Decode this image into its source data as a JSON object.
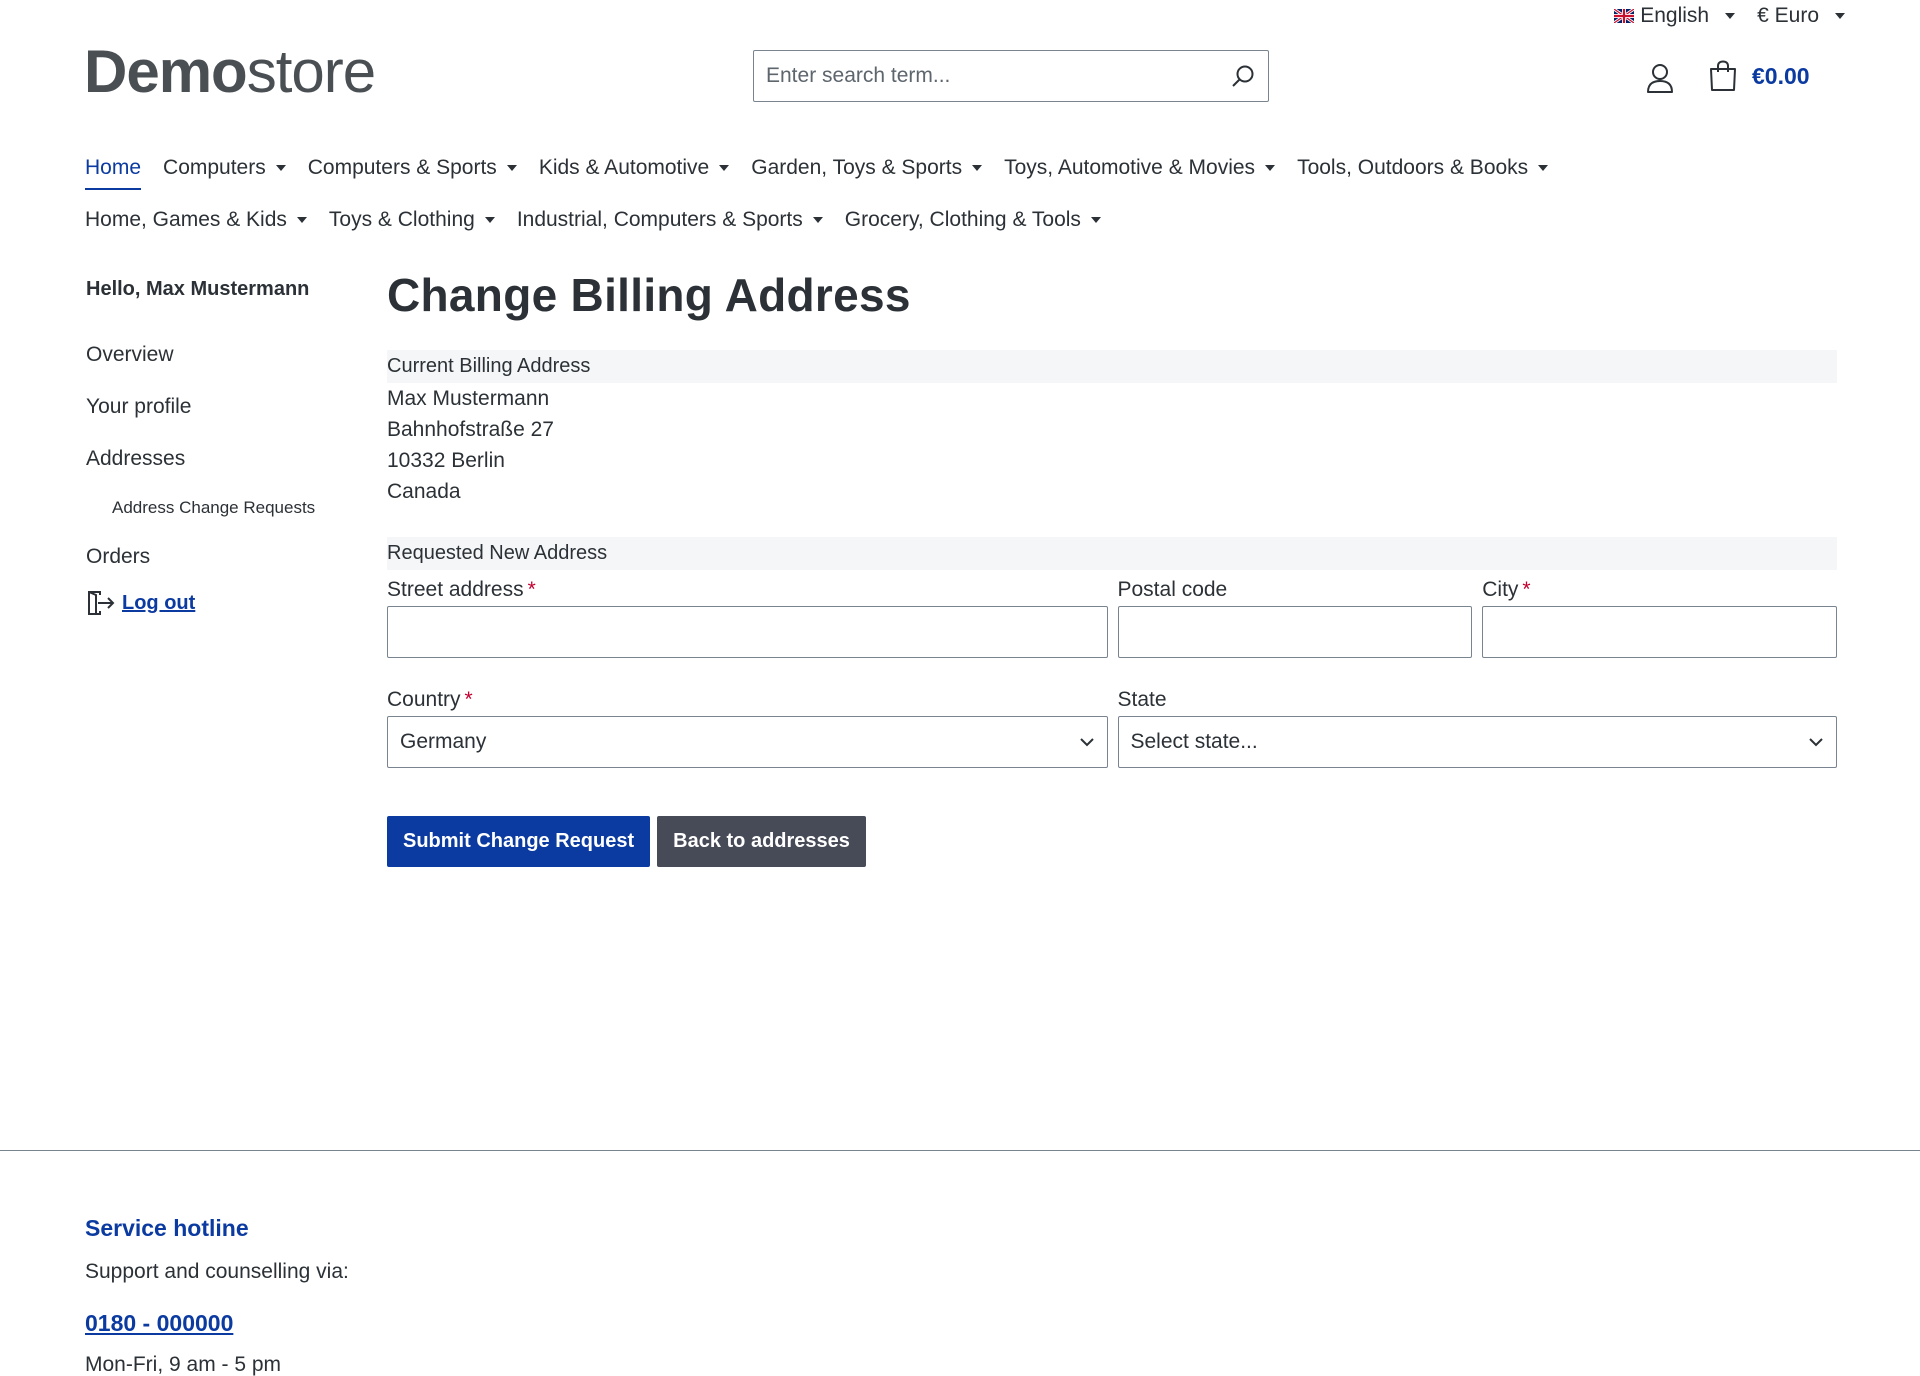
{
  "topbar": {
    "language": "English",
    "currency": "€ Euro"
  },
  "header": {
    "logo_bold": "Demo",
    "logo_light": "store",
    "search_placeholder": "Enter search term...",
    "cart_total": "€0.00"
  },
  "nav": {
    "row1": [
      {
        "label": "Home",
        "active": true,
        "dropdown": false
      },
      {
        "label": "Computers",
        "dropdown": true
      },
      {
        "label": "Computers & Sports",
        "dropdown": true
      },
      {
        "label": "Kids & Automotive",
        "dropdown": true
      },
      {
        "label": "Garden, Toys & Sports",
        "dropdown": true
      },
      {
        "label": "Toys, Automotive & Movies",
        "dropdown": true
      },
      {
        "label": "Tools, Outdoors & Books",
        "dropdown": true
      }
    ],
    "row2": [
      {
        "label": "Home, Games & Kids",
        "dropdown": true
      },
      {
        "label": "Toys & Clothing",
        "dropdown": true
      },
      {
        "label": "Industrial, Computers & Sports",
        "dropdown": true
      },
      {
        "label": "Grocery, Clothing & Tools",
        "dropdown": true
      }
    ]
  },
  "sidebar": {
    "greeting": "Hello, Max Mustermann",
    "overview": "Overview",
    "profile": "Your profile",
    "addresses": "Addresses",
    "address_change_requests": "Address Change Requests",
    "orders": "Orders",
    "logout": "Log out"
  },
  "main": {
    "title": "Change Billing Address",
    "current_heading": "Current Billing Address",
    "current_address": [
      "Max Mustermann",
      "Bahnhofstraße 27",
      "10332 Berlin",
      "Canada"
    ],
    "new_heading": "Requested New Address",
    "street_label": "Street address",
    "postal_label": "Postal code",
    "city_label": "City",
    "country_label": "Country",
    "country_value": "Germany",
    "state_label": "State",
    "state_value": "Select state...",
    "required_mark": "*",
    "submit_button": "Submit Change Request",
    "back_button": "Back to addresses"
  },
  "footer": {
    "heading": "Service hotline",
    "text": "Support and counselling via:",
    "phone": "0180 - 000000",
    "hours": "Mon-Fri, 9 am - 5 pm"
  },
  "colors": {
    "accent": "#0b3aa0",
    "secondary_button": "#474a57",
    "required": "#c2002f"
  }
}
